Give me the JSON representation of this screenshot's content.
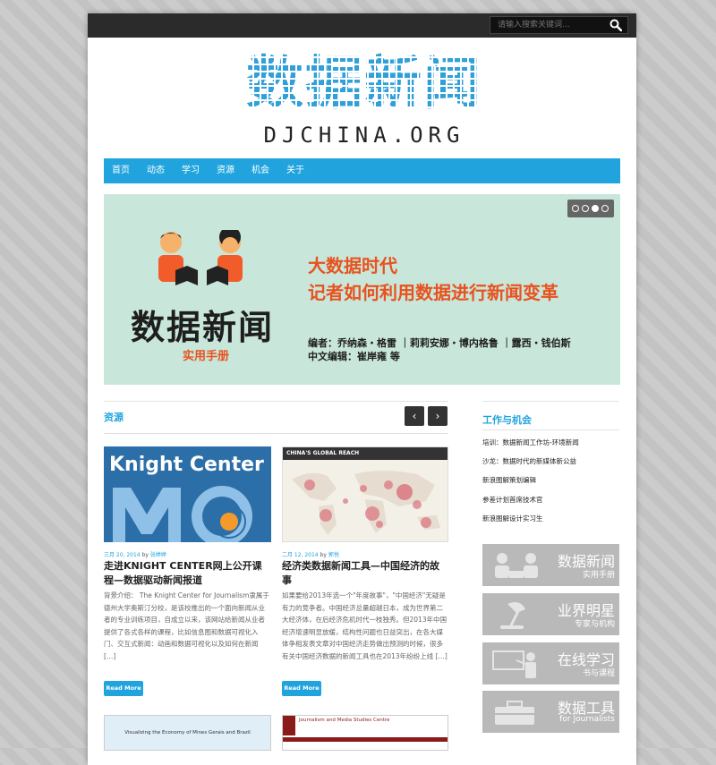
{
  "search": {
    "placeholder": "请输入搜索关键词..."
  },
  "logo": {
    "title": "数据新闻",
    "subtitle": "DJCHINA.ORG"
  },
  "nav": [
    "首页",
    "动态",
    "学习",
    "资源",
    "机会",
    "关于"
  ],
  "banner": {
    "headline1": "大数据时代",
    "headline2": "记者如何利用数据进行新闻变革",
    "big_title": "数据新闻",
    "handbook": "实用手册",
    "authors": "编者：乔纳森・格雷 ｜莉莉安娜・博内格鲁 ｜露西・钱伯斯",
    "translators": "中文编辑：崔岸雍 等",
    "slider_dots": 4,
    "active_dot": 3
  },
  "resources": {
    "title": "资源",
    "prev": "‹",
    "next": "›",
    "posts": [
      {
        "thumb_text": "Knight Center",
        "date": "三月 20, 2014",
        "by": "by",
        "author": "张婷婷",
        "title": "走进KNIGHT CENTER网上公开课程—数据驱动新闻报道",
        "excerpt": "背景介绍： The Knight Center for Journalism隶属于德州大学奥斯汀分校，是该校推出的一个面向新闻从业者的专业训练项目，自成立以来，该网站给新闻从业者提供了各式各样的课程，比如信息图和数据可视化入门、交互式新闻：动画和数据可视化以及如何在新闻 […]",
        "read_more": "Read More"
      },
      {
        "thumb_text": "CHINA'S GLOBAL REACH",
        "date": "二月 12, 2014",
        "by": "by",
        "author": "郭悦",
        "title": "经济类数据新闻工具—中国经济的故事",
        "excerpt": "如果要给2013年选一个\"年度故事\"，\"中国经济\"无疑是有力的竞争者。中国经济总量超越日本，成为世界第二大经济体，在后经济危机时代一枝独秀。但2013年中国经济增速明显放缓，结构性问题也日益突出，在各大媒体争相发表文章对中国经济走势做出预测的时候，很多有关中国经济数据的新闻工具也在2013年纷纷上线 […]",
        "read_more": "Read More"
      }
    ],
    "bottom_thumbs": [
      "Visualizing the Economy of Mines Gerais and Brazil",
      "Journalism and Media Studies Centre"
    ]
  },
  "sidebar": {
    "title": "工作与机会",
    "links": [
      "培训：数据新闻工作坊-环境新闻",
      "沙龙：数据时代的新媒体新公益",
      "新浪图解策划编辑",
      "参差计划首席技术官",
      "新浪图解设计实习生"
    ],
    "tiles": [
      {
        "title": "数据新闻",
        "sub": "实用手册"
      },
      {
        "title": "业界明星",
        "sub": "专家与机构"
      },
      {
        "title": "在线学习",
        "sub": "书与课程"
      },
      {
        "title": "数据工具",
        "sub": "for Journalists"
      }
    ]
  },
  "colors": {
    "accent": "#21a4de",
    "banner_bg": "#c8e6d9",
    "headline": "#e8521e"
  }
}
